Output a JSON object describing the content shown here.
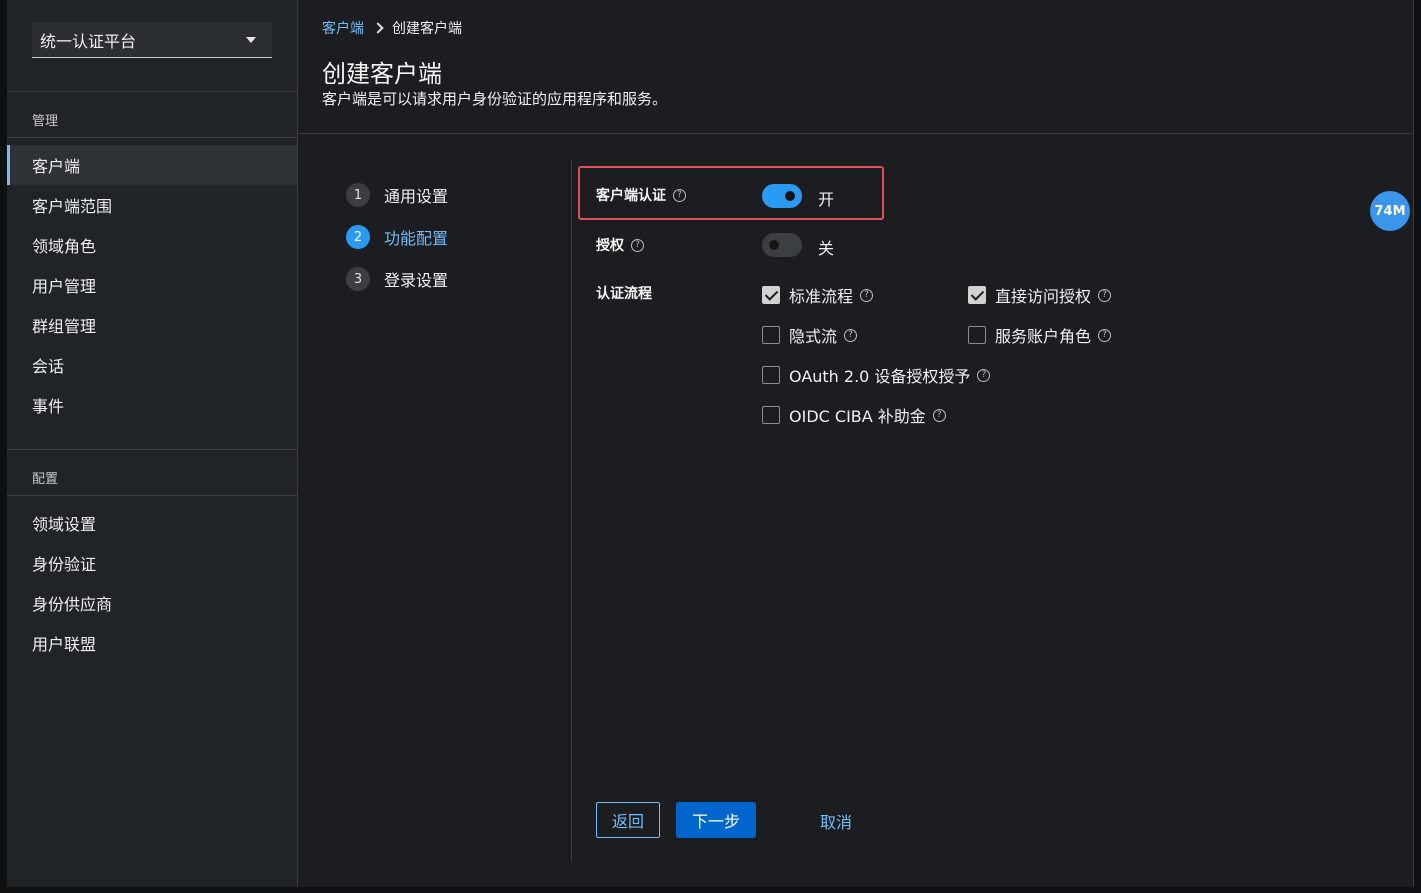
{
  "sidebar": {
    "realm_selector": {
      "value": "统一认证平台"
    },
    "sections": [
      {
        "title": "管理",
        "items": [
          "客户端",
          "客户端范围",
          "领域角色",
          "用户管理",
          "群组管理",
          "会话",
          "事件"
        ]
      },
      {
        "title": "配置",
        "items": [
          "领域设置",
          "身份验证",
          "身份供应商",
          "用户联盟"
        ]
      }
    ],
    "active_item": "客户端"
  },
  "breadcrumb": {
    "parent": "客户端",
    "current": "创建客户端"
  },
  "page": {
    "title": "创建客户端",
    "description": "客户端是可以请求用户身份验证的应用程序和服务。"
  },
  "wizard": {
    "steps": [
      {
        "number": "1",
        "label": "通用设置"
      },
      {
        "number": "2",
        "label": "功能配置"
      },
      {
        "number": "3",
        "label": "登录设置"
      }
    ],
    "active_step": 2
  },
  "form": {
    "client_auth": {
      "label": "客户端认证",
      "state": "on",
      "state_text": "开"
    },
    "authorization": {
      "label": "授权",
      "state": "off",
      "state_text": "关"
    },
    "auth_flow": {
      "label": "认证流程",
      "options": [
        {
          "label": "标准流程",
          "checked": true
        },
        {
          "label": "直接访问授权",
          "checked": true
        },
        {
          "label": "隐式流",
          "checked": false
        },
        {
          "label": "服务账户角色",
          "checked": false
        },
        {
          "label": "OAuth 2.0 设备授权授予",
          "checked": false
        },
        {
          "label": "OIDC CIBA 补助金",
          "checked": false
        }
      ]
    }
  },
  "buttons": {
    "back": "返回",
    "next": "下一步",
    "cancel": "取消"
  },
  "memory_badge": "74M",
  "colors": {
    "accent": "#2b9af3",
    "link": "#73bcf7",
    "primary_button": "#0066cc",
    "highlight": "#e0505b"
  }
}
